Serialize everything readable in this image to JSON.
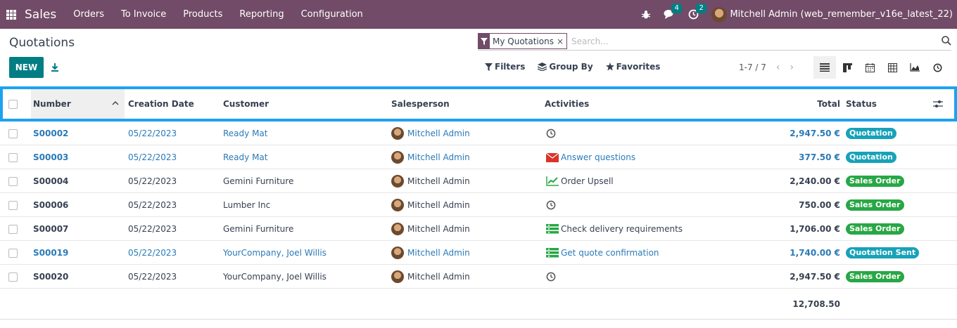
{
  "navbar": {
    "app_name": "Sales",
    "menu": [
      "Orders",
      "To Invoice",
      "Products",
      "Reporting",
      "Configuration"
    ],
    "messages_count": "4",
    "activities_count": "2",
    "user": "Mitchell Admin (web_remember_v16e_latest_22)"
  },
  "control": {
    "title": "Quotations",
    "new_label": "NEW",
    "facet_label": "My Quotations",
    "facet_close": "×",
    "search_placeholder": "Search...",
    "filters_label": "Filters",
    "groupby_label": "Group By",
    "favorites_label": "Favorites",
    "pager": "1-7 / 7"
  },
  "table": {
    "headers": {
      "number": "Number",
      "creation_date": "Creation Date",
      "customer": "Customer",
      "salesperson": "Salesperson",
      "activities": "Activities",
      "total": "Total",
      "status": "Status"
    },
    "rows": [
      {
        "number": "S00002",
        "date": "05/22/2023",
        "customer": "Ready Mat",
        "salesperson": "Mitchell Admin",
        "activity": "",
        "activity_icon": "clock-icon",
        "total": "2,947.50 €",
        "status": "Quotation",
        "highlight": true
      },
      {
        "number": "S00003",
        "date": "05/22/2023",
        "customer": "Ready Mat",
        "salesperson": "Mitchell Admin",
        "activity": "Answer questions",
        "activity_icon": "email-icon",
        "total": "377.50 €",
        "status": "Quotation",
        "highlight": true
      },
      {
        "number": "S00004",
        "date": "05/22/2023",
        "customer": "Gemini Furniture",
        "salesperson": "Mitchell Admin",
        "activity": "Order Upsell",
        "activity_icon": "chart-line-icon",
        "total": "2,240.00 €",
        "status": "Sales Order",
        "highlight": false
      },
      {
        "number": "S00006",
        "date": "05/22/2023",
        "customer": "Lumber Inc",
        "salesperson": "Mitchell Admin",
        "activity": "",
        "activity_icon": "clock-icon",
        "total": "750.00 €",
        "status": "Sales Order",
        "highlight": false
      },
      {
        "number": "S00007",
        "date": "05/22/2023",
        "customer": "Gemini Furniture",
        "salesperson": "Mitchell Admin",
        "activity": "Check delivery requirements",
        "activity_icon": "tasks-icon",
        "total": "1,706.00 €",
        "status": "Sales Order",
        "highlight": false
      },
      {
        "number": "S00019",
        "date": "05/22/2023",
        "customer": "YourCompany, Joel Willis",
        "salesperson": "Mitchell Admin",
        "activity": "Get quote confirmation",
        "activity_icon": "tasks-icon",
        "total": "1,740.00 €",
        "status": "Quotation Sent",
        "highlight": true
      },
      {
        "number": "S00020",
        "date": "05/22/2023",
        "customer": "YourCompany, Joel Willis",
        "salesperson": "Mitchell Admin",
        "activity": "",
        "activity_icon": "clock-icon",
        "total": "2,947.50 €",
        "status": "Sales Order",
        "highlight": false
      }
    ],
    "sum_total": "12,708.50"
  },
  "colors": {
    "navbar": "#714b67",
    "primary": "#017e84",
    "quotation": "#17a2b8",
    "sales_order": "#28a745",
    "focus_border": "#1da1f2"
  }
}
